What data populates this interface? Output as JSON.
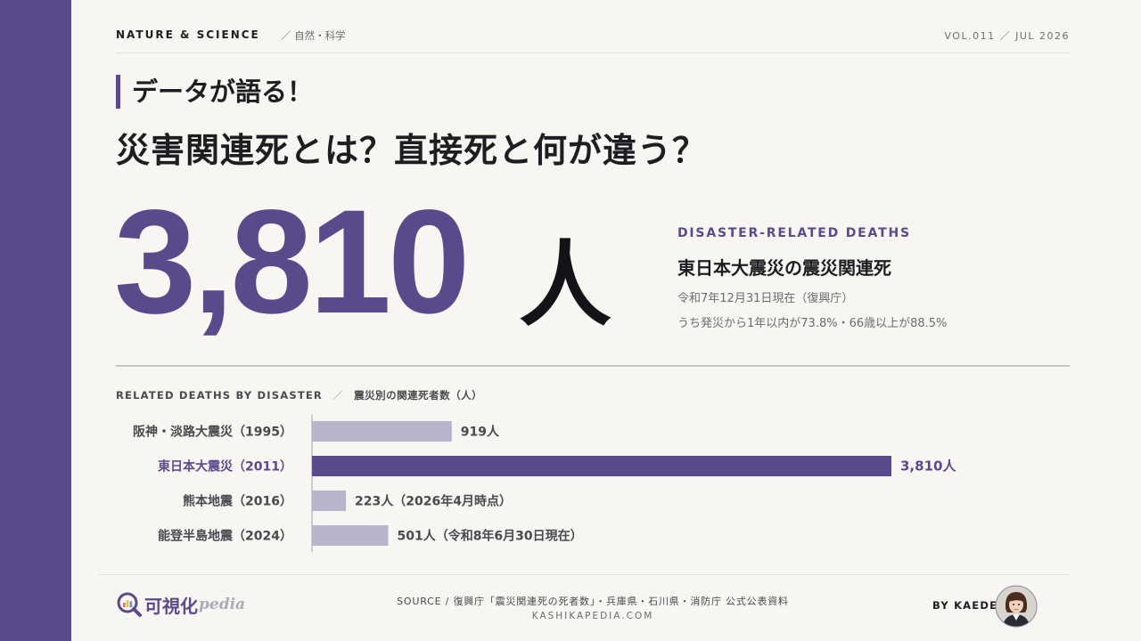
{
  "header": {
    "category": "NATURE & SCIENCE",
    "category_jp": "／ 自然・科学",
    "volume": "VOL.011 ／ JUL 2026"
  },
  "kicker": "データが語る！",
  "title": "災害関連死とは？直接死と何が違う？",
  "headline_stat": {
    "number": "3,810",
    "unit": "人",
    "label_en": "DISASTER-RELATED DEATHS",
    "label_jp": "東日本大震災の震災関連死",
    "note1": "令和7年12月31日現在（復興庁）",
    "note2": "うち発災から1年以内が73.8%・66歳以上が88.5%"
  },
  "chart_heading": {
    "en": "RELATED DEATHS BY DISASTER",
    "sep": "／",
    "jp": "震災別の関連死者数（人）"
  },
  "chart_data": {
    "type": "bar",
    "orientation": "horizontal",
    "categories": [
      "阪神・淡路大震災（1995）",
      "東日本大震災（2011）",
      "熊本地震（2016）",
      "能登半島地震（2024）"
    ],
    "values": [
      919,
      3810,
      223,
      501
    ],
    "value_labels": [
      "919人",
      "3,810人",
      "223人（2026年4月時点）",
      "501人（令和8年6月30日現在）"
    ],
    "highlight_index": 1,
    "colors": {
      "highlight": "#5b4a8b",
      "default": "#b9b3cc",
      "label": "#4b4950"
    }
  },
  "footer": {
    "logo_main": "可視化",
    "logo_suffix": "pedia",
    "source": "SOURCE / 復興庁「震災関連死の死者数」・兵庫県・石川県・消防庁 公式公表資料",
    "site": "KASHIKAPEDIA.COM",
    "byline": "BY KAEDE"
  },
  "colors": {
    "accent": "#5b4a8b",
    "background": "#f7f6f2",
    "text": "#1f1d22"
  }
}
